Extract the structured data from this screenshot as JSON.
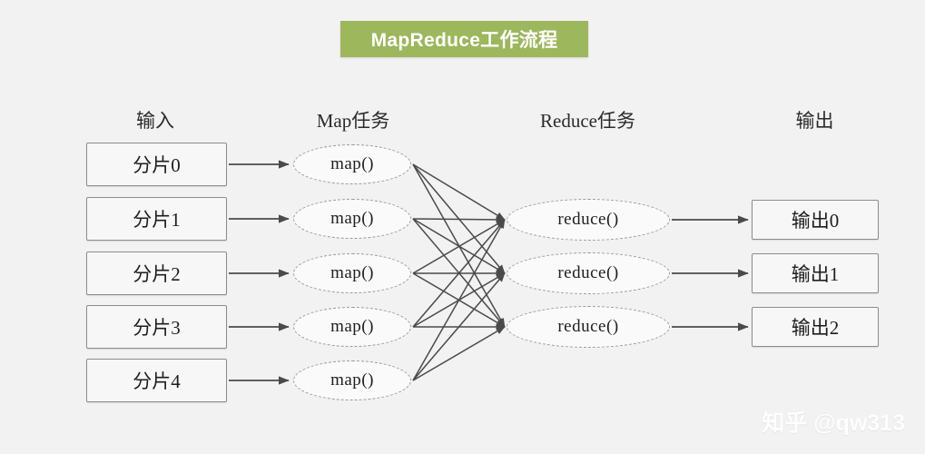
{
  "title": {
    "text": "MapReduce工作流程",
    "banner_color": "#9cb75c",
    "text_color": "#ffffff"
  },
  "background_color": "#f2f2f2",
  "columns": [
    {
      "label": "输入"
    },
    {
      "label": "Map任务"
    },
    {
      "label": "Reduce任务"
    },
    {
      "label": "输出"
    }
  ],
  "inputs": [
    {
      "label": "分片0"
    },
    {
      "label": "分片1"
    },
    {
      "label": "分片2"
    },
    {
      "label": "分片3"
    },
    {
      "label": "分片4"
    }
  ],
  "maps": [
    {
      "label": "map()"
    },
    {
      "label": "map()"
    },
    {
      "label": "map()"
    },
    {
      "label": "map()"
    },
    {
      "label": "map()"
    }
  ],
  "reduces": [
    {
      "label": "reduce()"
    },
    {
      "label": "reduce()"
    },
    {
      "label": "reduce()"
    }
  ],
  "outputs": [
    {
      "label": "输出0"
    },
    {
      "label": "输出1"
    },
    {
      "label": "输出2"
    }
  ],
  "watermark": {
    "text": "知乎 @qw313"
  },
  "edge_color": "#4a4a4a"
}
